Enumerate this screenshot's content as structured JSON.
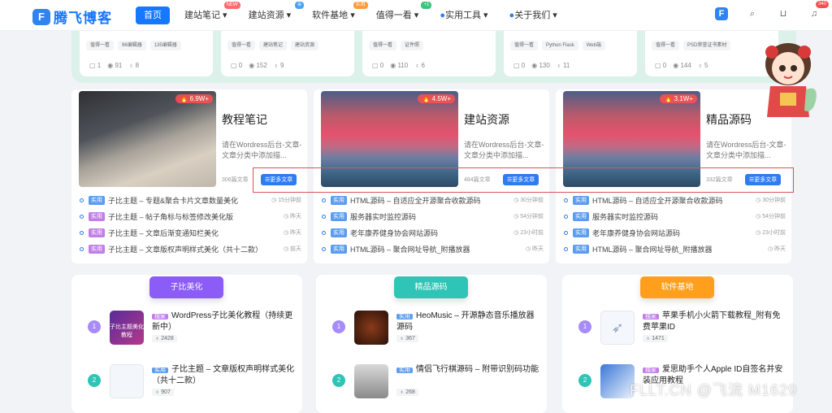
{
  "brand": {
    "name": "腾飞博客",
    "mark": "F"
  },
  "nav": {
    "items": [
      {
        "label": "首页"
      },
      {
        "label": "建站笔记",
        "badge": "NEW",
        "badge_color": "#ff6b6b"
      },
      {
        "label": "建站资源",
        "badge": "⊕",
        "badge_color": "#4aa3f0"
      },
      {
        "label": "软件基地",
        "badge": "实用",
        "badge_color": "#ff9a3d"
      },
      {
        "label": "值得一看",
        "badge": "+1",
        "badge_color": "#3cc47c"
      },
      {
        "label": "实用工具"
      },
      {
        "label": "关于我们"
      }
    ],
    "cart_badge": "340"
  },
  "top_cards": [
    {
      "tags": [
        "值得一看",
        "96编辑器",
        "135编辑器"
      ],
      "comments": "1",
      "views": "91",
      "likes": "8"
    },
    {
      "tags": [
        "值得一看",
        "建站笔记",
        "建站资源"
      ],
      "comments": "0",
      "views": "152",
      "likes": "9"
    },
    {
      "tags": [
        "值得一看",
        "证件照"
      ],
      "comments": "0",
      "views": "110",
      "likes": "6"
    },
    {
      "tags": [
        "值得一看",
        "Python Flask",
        "Web端"
      ],
      "comments": "0",
      "views": "130",
      "likes": "11"
    },
    {
      "tags": [
        "值得一看",
        "PSD荣誉证书素材"
      ],
      "comments": "0",
      "views": "144",
      "likes": "5"
    }
  ],
  "categories": [
    {
      "title": "教程笔记",
      "hot": "6.9W+",
      "desc": "请在Wordress后台-文章-文章分类中添加描...",
      "count": "306篇文章",
      "more": "更多文章",
      "posts": [
        {
          "tag": "实用",
          "tag_color": "#5b9cf0",
          "title": "子比主题 – 专题&聚合卡片文章数量美化",
          "time": "15分钟前"
        },
        {
          "tag": "实用",
          "tag_color": "#c27ee8",
          "title": "子比主题 – 帖子角标与标签修改美化版",
          "time": "昨天"
        },
        {
          "tag": "实用",
          "tag_color": "#c27ee8",
          "title": "子比主题 – 文章后渐变通知栏美化",
          "time": "昨天"
        },
        {
          "tag": "实用",
          "tag_color": "#c27ee8",
          "title": "子比主题 – 文章版权声明样式美化（共十二款）",
          "time": "前天"
        }
      ]
    },
    {
      "title": "建站资源",
      "hot": "4.5W+",
      "desc": "请在Wordress后台-文章-文章分类中添加描...",
      "count": "484篇文章",
      "more": "更多文章",
      "posts": [
        {
          "tag": "实用",
          "tag_color": "#5b9cf0",
          "title": "HTML源码 – 自适应全开源聚合收款源码",
          "time": "30分钟前"
        },
        {
          "tag": "实用",
          "tag_color": "#5b9cf0",
          "title": "服务器实时监控源码",
          "time": "54分钟前"
        },
        {
          "tag": "实用",
          "tag_color": "#5b9cf0",
          "title": "老年康养健身协会网站源码",
          "time": "23小时前"
        },
        {
          "tag": "实用",
          "tag_color": "#5b9cf0",
          "title": "HTML源码 – 聚合网址导航_附播放器",
          "time": "昨天"
        }
      ]
    },
    {
      "title": "精品源码",
      "hot": "3.1W+",
      "desc": "请在Wordress后台-文章-文章分类中添加描...",
      "count": "332篇文章",
      "more": "更多文章",
      "posts": [
        {
          "tag": "实用",
          "tag_color": "#5b9cf0",
          "title": "HTML源码 – 自适应全开源聚合收款源码",
          "time": "30分钟前"
        },
        {
          "tag": "实用",
          "tag_color": "#5b9cf0",
          "title": "服务器实时监控源码",
          "time": "54分钟前"
        },
        {
          "tag": "实用",
          "tag_color": "#5b9cf0",
          "title": "老年康养健身协会网站源码",
          "time": "23小时前"
        },
        {
          "tag": "实用",
          "tag_color": "#5b9cf0",
          "title": "HTML源码 – 聚合网址导航_附播放器",
          "time": "昨天"
        }
      ]
    }
  ],
  "rankings": [
    {
      "title": "子比美化",
      "color": "#8b5cf6",
      "items": [
        {
          "num": "1",
          "tag": "独家",
          "tag_color": "#c27ee8",
          "title": "WordPress子比美化教程（持续更新中）",
          "views": "2428",
          "thumb_text": "子比主题美化教程"
        },
        {
          "num": "2",
          "tag": "实用",
          "tag_color": "#5b9cf0",
          "title": "子比主题 – 文章版权声明样式美化（共十二款）",
          "views": "907",
          "thumb_text": ""
        }
      ]
    },
    {
      "title": "精品源码",
      "color": "#2ec4b6",
      "items": [
        {
          "num": "1",
          "tag": "实用",
          "tag_color": "#5b9cf0",
          "title": "HeoMusic – 开源静态音乐播放器源码",
          "views": "367",
          "thumb_text": ""
        },
        {
          "num": "2",
          "tag": "实用",
          "tag_color": "#5b9cf0",
          "title": "情侣飞行棋源码 – 附带识别码功能",
          "views": "268",
          "thumb_text": ""
        }
      ]
    },
    {
      "title": "软件基地",
      "color": "#ff9f1c",
      "items": [
        {
          "num": "1",
          "tag": "独家",
          "tag_color": "#c27ee8",
          "title": "苹果手机小火箭下载教程_附有免费苹果ID",
          "views": "1471",
          "thumb_text": ""
        },
        {
          "num": "2",
          "tag": "独家",
          "tag_color": "#c27ee8",
          "title": "爱思助手个人Apple ID自签名并安装应用教程",
          "views": "",
          "thumb_text": ""
        }
      ]
    }
  ],
  "watermark": "FLLT.CN @飞流 M1629"
}
